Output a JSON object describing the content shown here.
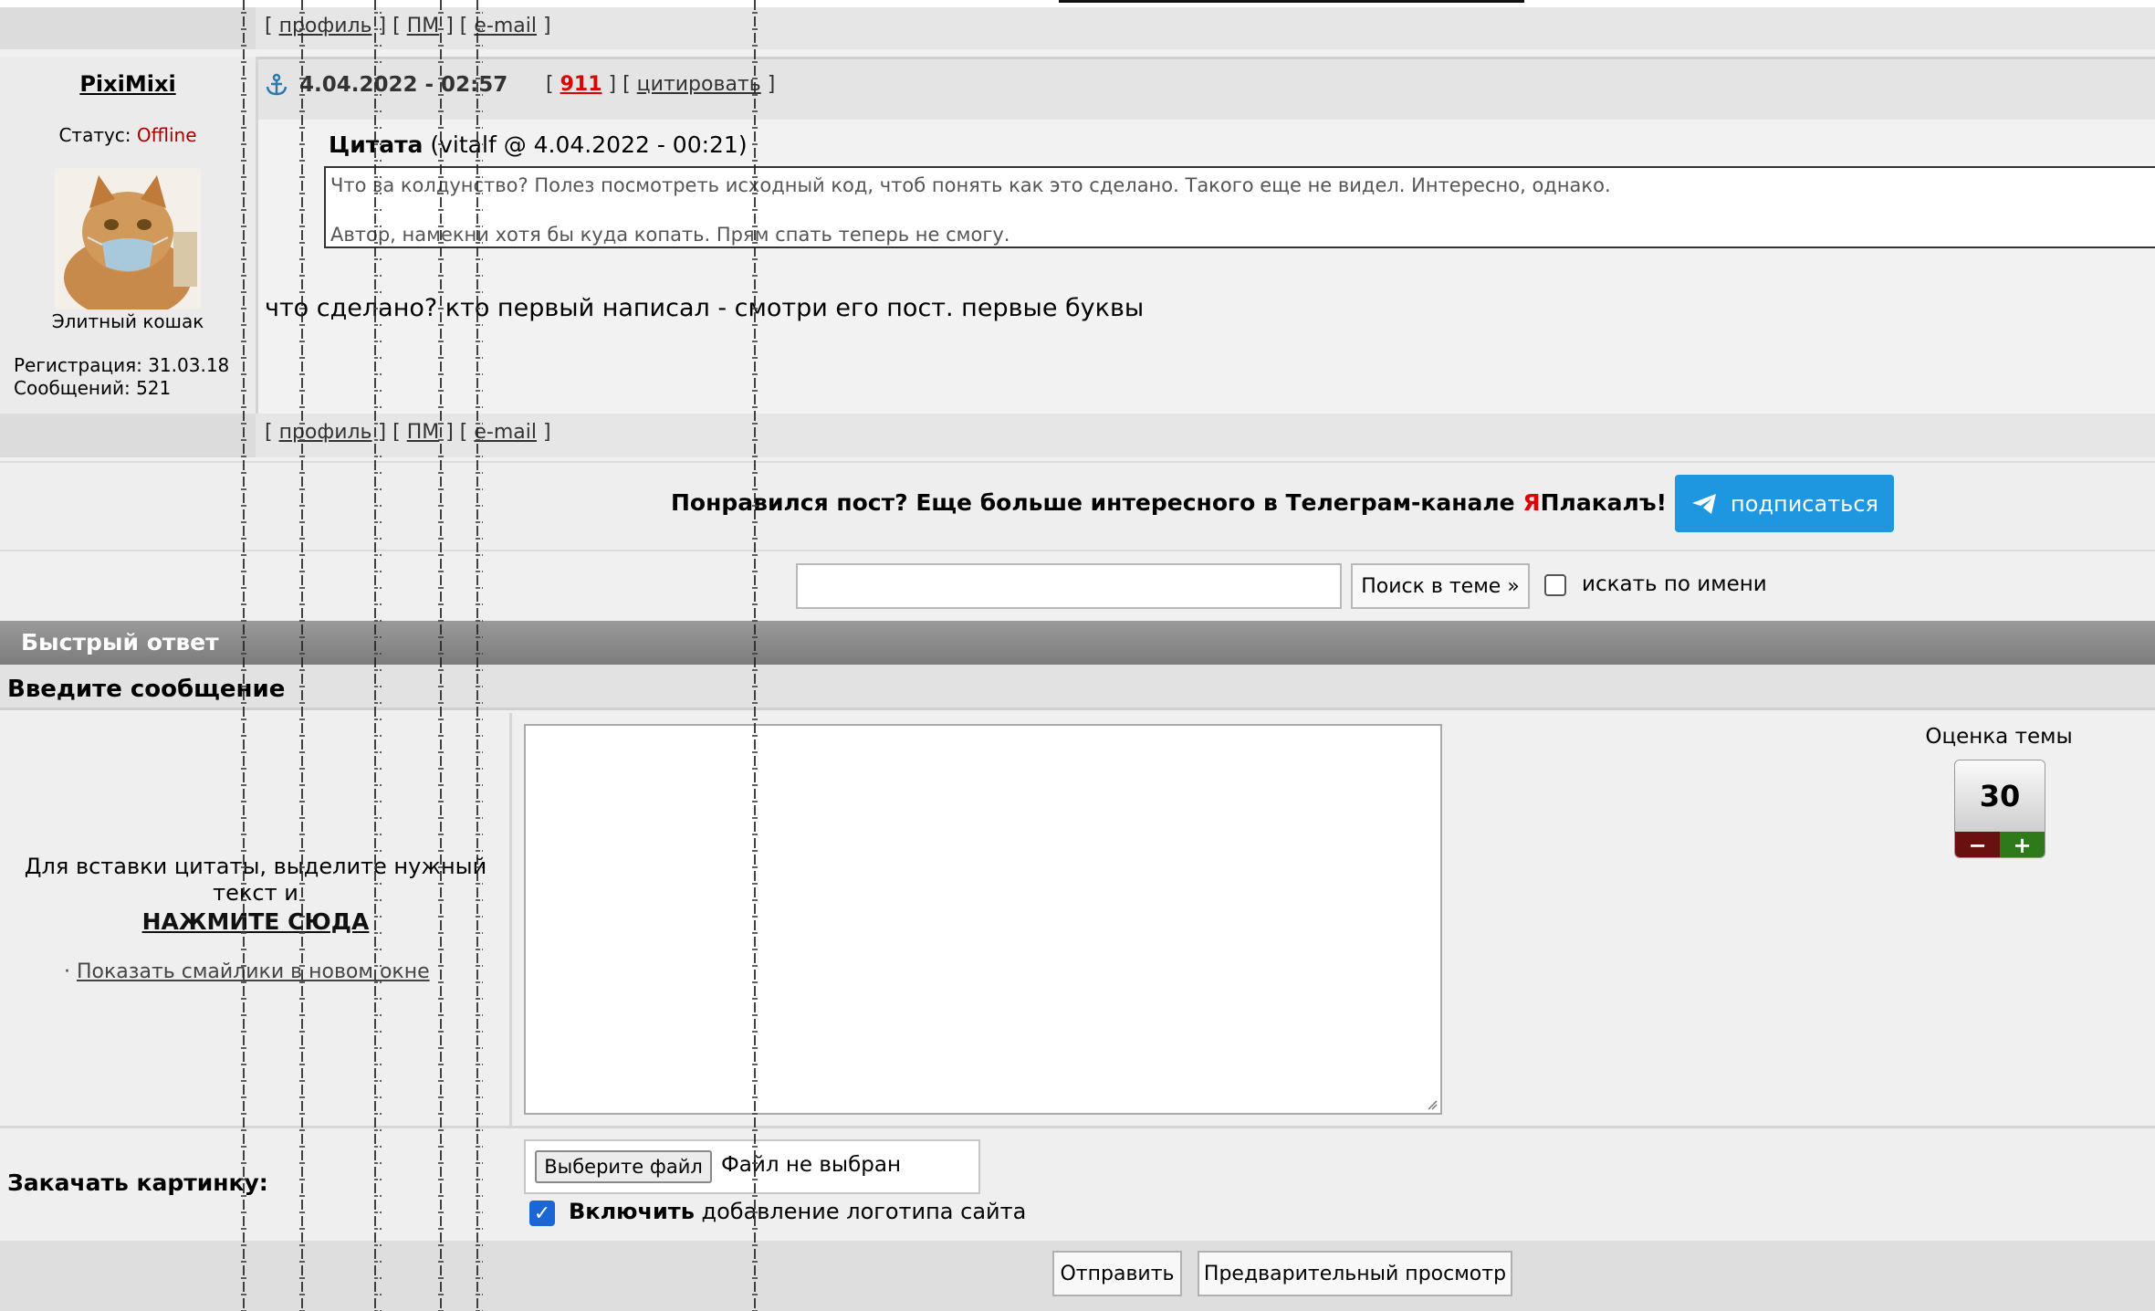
{
  "post_footer_links": {
    "profile": "профиль",
    "pm": "ПМ",
    "email": "e-mail"
  },
  "post": {
    "author": "PixiMixi",
    "status_label": "Статус:",
    "status_value": "Offline",
    "rank": "Элитный кошак",
    "registration": "Регистрация: 31.03.18",
    "messages": "Сообщений: 521",
    "date": "4.04.2022 - 02:57",
    "post_number": "911",
    "quote_link": "цитировать",
    "quote_title": "Цитата",
    "quote_meta": " (vitalf @ 4.04.2022 - 00:21)",
    "quote_line1": "Что за колдунство? Полез посмотреть исходный код, чтоб понять как это сделано. Такого еще не видел. Интересно, однако.",
    "quote_line2": "Автор, намекни хотя бы куда копать. Прям спать теперь не смогу.",
    "text": "что сделано? кто первый написал - смотри его пост. первые буквы"
  },
  "telegram": {
    "text_before": "Понравился пост? Еще больше интересного в Телеграм-канале ",
    "brand_y": "Я",
    "brand_rest": "Плакалъ!",
    "button": "подписаться"
  },
  "search": {
    "button": "Поиск в теме »",
    "checkbox_label": "искать по имени",
    "input_value": ""
  },
  "quick_reply": {
    "title": "Быстрый ответ",
    "message_header": "Введите сообщение",
    "hint_line": "Для вставки цитаты, выделите нужный текст и",
    "hint_click": "НАЖМИТЕ СЮДА",
    "smileys_bullet": "·",
    "smileys_link": "Показать смайлики в новом окне",
    "rating_label": "Оценка темы",
    "rating_value": "30",
    "rating_minus": "−",
    "rating_plus": "+",
    "upload_label": "Закачать картинку:",
    "file_button": "Выберите файл",
    "file_status": "Файл не выбран",
    "logo_bold": "Включить",
    "logo_rest": " добавление логотипа сайта",
    "submit": "Отправить",
    "preview": "Предварительный просмотр"
  },
  "colors": {
    "telegram_button": "#1e96e0",
    "offline": "#a40000",
    "post_number": "#e00000"
  }
}
